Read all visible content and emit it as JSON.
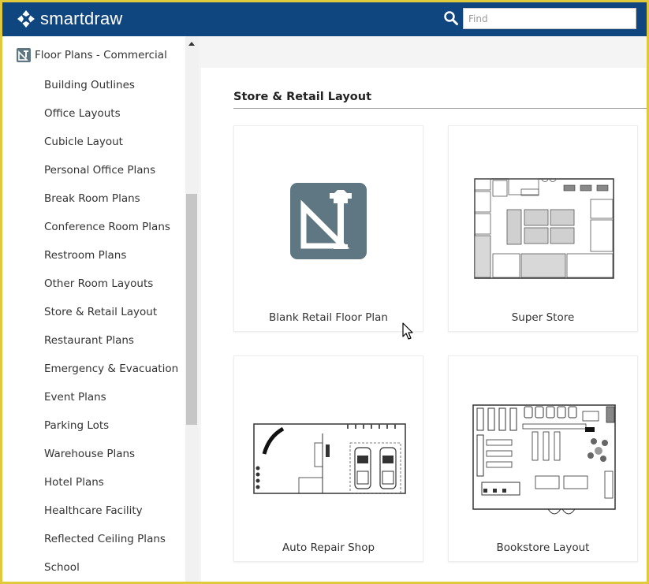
{
  "app": {
    "logo_text": "smartdraw",
    "search_placeholder": "Find"
  },
  "sidebar": {
    "header": "Floor Plans - Commercial",
    "items": [
      {
        "label": "Building Outlines"
      },
      {
        "label": "Office Layouts"
      },
      {
        "label": "Cubicle Layout"
      },
      {
        "label": "Personal Office Plans"
      },
      {
        "label": "Break Room Plans"
      },
      {
        "label": "Conference Room Plans"
      },
      {
        "label": "Restroom Plans"
      },
      {
        "label": "Other Room Layouts"
      },
      {
        "label": "Store & Retail Layout"
      },
      {
        "label": "Restaurant Plans"
      },
      {
        "label": "Emergency & Evacuation"
      },
      {
        "label": "Event Plans"
      },
      {
        "label": "Parking Lots"
      },
      {
        "label": "Warehouse Plans"
      },
      {
        "label": "Hotel Plans"
      },
      {
        "label": "Healthcare Facility"
      },
      {
        "label": "Reflected Ceiling Plans"
      },
      {
        "label": "School"
      }
    ]
  },
  "main": {
    "section_title": "Store & Retail Layout",
    "templates": [
      {
        "label": "Blank Retail Floor Plan"
      },
      {
        "label": "Super Store"
      },
      {
        "label": "Auto Repair Shop"
      },
      {
        "label": "Bookstore Layout"
      }
    ]
  },
  "colors": {
    "topbar": "#10467f",
    "blank_icon_bg": "#5f7683",
    "frame_border": "#e0c93a"
  }
}
